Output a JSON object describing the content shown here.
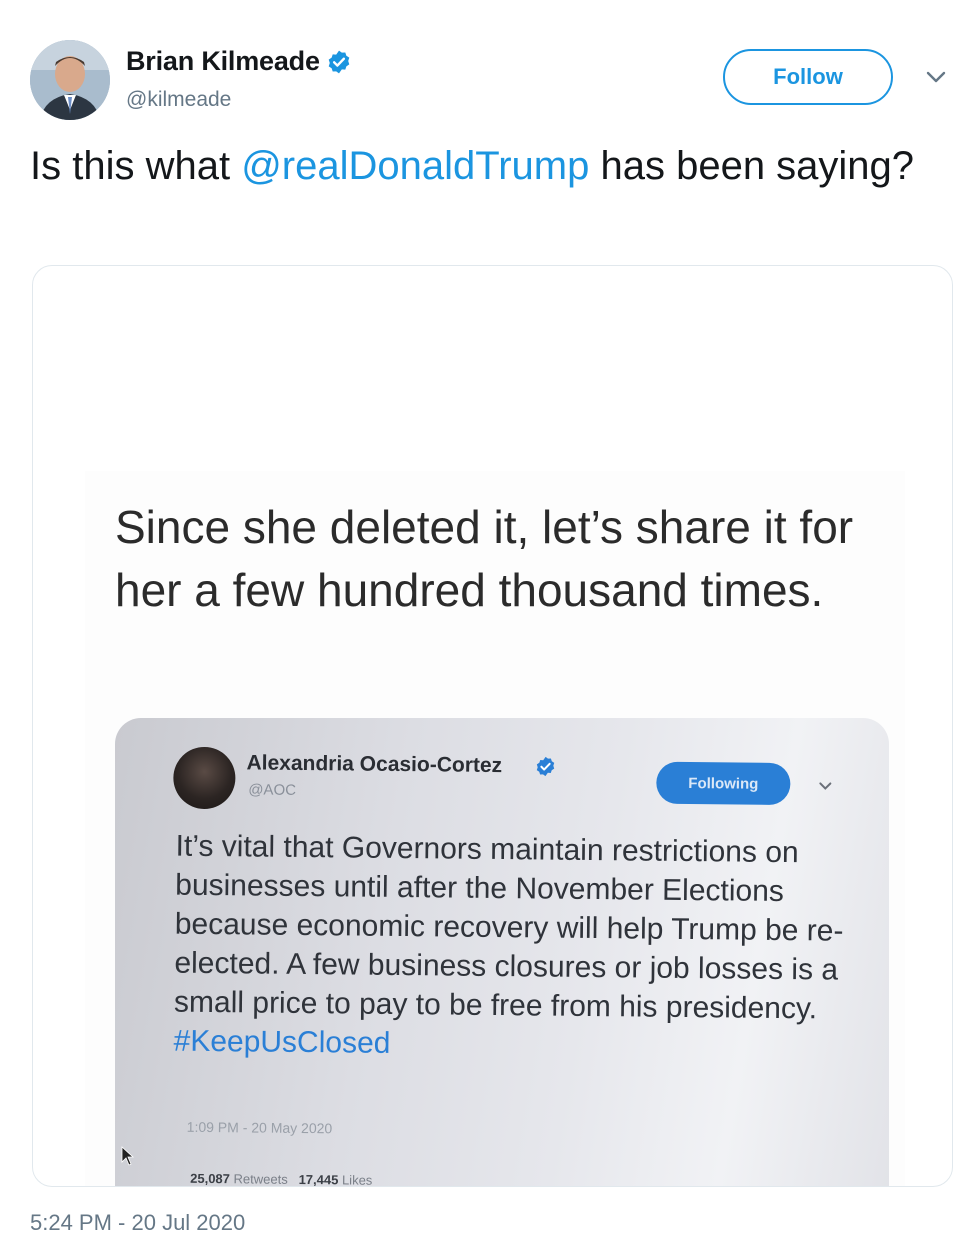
{
  "author": {
    "display_name": "Brian Kilmeade",
    "handle": "@kilmeade",
    "verified": true
  },
  "actions": {
    "follow_label": "Follow",
    "more_icon": "chevron-down-icon"
  },
  "tweet": {
    "text_before": "Is this what ",
    "mention": "@realDonaldTrump",
    "text_after": " has been saying?",
    "timestamp": "5:24 PM - 20 Jul 2020"
  },
  "embedded_image": {
    "caption": "Since she deleted it, let’s share it for her a few hundred thousand times.",
    "screenshot": {
      "display_name": "Alexandria Ocasio-Cortez",
      "handle": "@AOC",
      "following_label": "Following",
      "text": "It’s vital that Governors maintain restrictions on businesses until after the November Elections because economic recovery will help Trump be re-elected. A few business closures or job losses is a small price to pay to be free from his presidency. ",
      "hashtag": "#KeepUsClosed",
      "time": "1:09 PM - 20 May 2020",
      "retweets_count": "25,087",
      "retweets_label": "Retweets",
      "likes_count": "17,445",
      "likes_label": "Likes"
    }
  },
  "colors": {
    "link_blue": "#1b95e0",
    "text": "#14171a",
    "secondary": "#657786",
    "border": "#e1e8ed"
  }
}
